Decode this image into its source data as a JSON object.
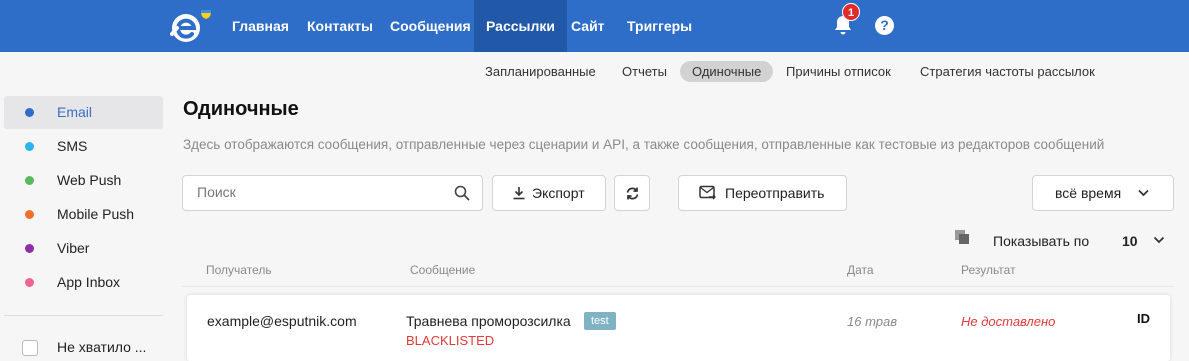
{
  "brand": {
    "primary": "#2f6ec8",
    "active_nav": "#2158a8",
    "error": "#e03a3a"
  },
  "nav": {
    "items": [
      {
        "label": "Главная"
      },
      {
        "label": "Контакты"
      },
      {
        "label": "Сообщения"
      },
      {
        "label": "Рассылки",
        "active": true
      },
      {
        "label": "Сайт"
      },
      {
        "label": "Триггеры"
      }
    ],
    "notifications_count": "1",
    "help_label": "?"
  },
  "subtabs": [
    {
      "label": "Запланированные"
    },
    {
      "label": "Отчеты"
    },
    {
      "label": "Одиночные",
      "active": true
    },
    {
      "label": "Причины отписок"
    },
    {
      "label": "Стратегия частоты рассылок"
    }
  ],
  "sidebar": {
    "channels": [
      {
        "label": "Email",
        "color": "#2f6ec8",
        "active": true
      },
      {
        "label": "SMS",
        "color": "#29b6e8"
      },
      {
        "label": "Web Push",
        "color": "#5cb85c"
      },
      {
        "label": "Mobile Push",
        "color": "#f0702a"
      },
      {
        "label": "Viber",
        "color": "#8e2fa8"
      },
      {
        "label": "App Inbox",
        "color": "#f06292"
      }
    ],
    "checkbox_label": "Не хватило ..."
  },
  "main": {
    "title": "Одиночные",
    "description": "Здесь отображаются сообщения, отправленные через сценарии и API, а также сообщения, отправленные как тестовые из редакторов сообщений",
    "search_placeholder": "Поиск",
    "export_label": "Экспорт",
    "resend_label": "Переотправить",
    "period_label": "всё время",
    "per_page_label": "Показывать по",
    "per_page_value": "10"
  },
  "table": {
    "columns": [
      "Получатель",
      "Сообщение",
      "Дата",
      "Результат"
    ],
    "rows": [
      {
        "recipient": "example@esputnik.com",
        "message": "Травнева проморозсилка",
        "tag": "test",
        "status_code": "BLACKLISTED",
        "date": "16 трав",
        "result": "Не доставлено",
        "id": "ID"
      }
    ]
  }
}
